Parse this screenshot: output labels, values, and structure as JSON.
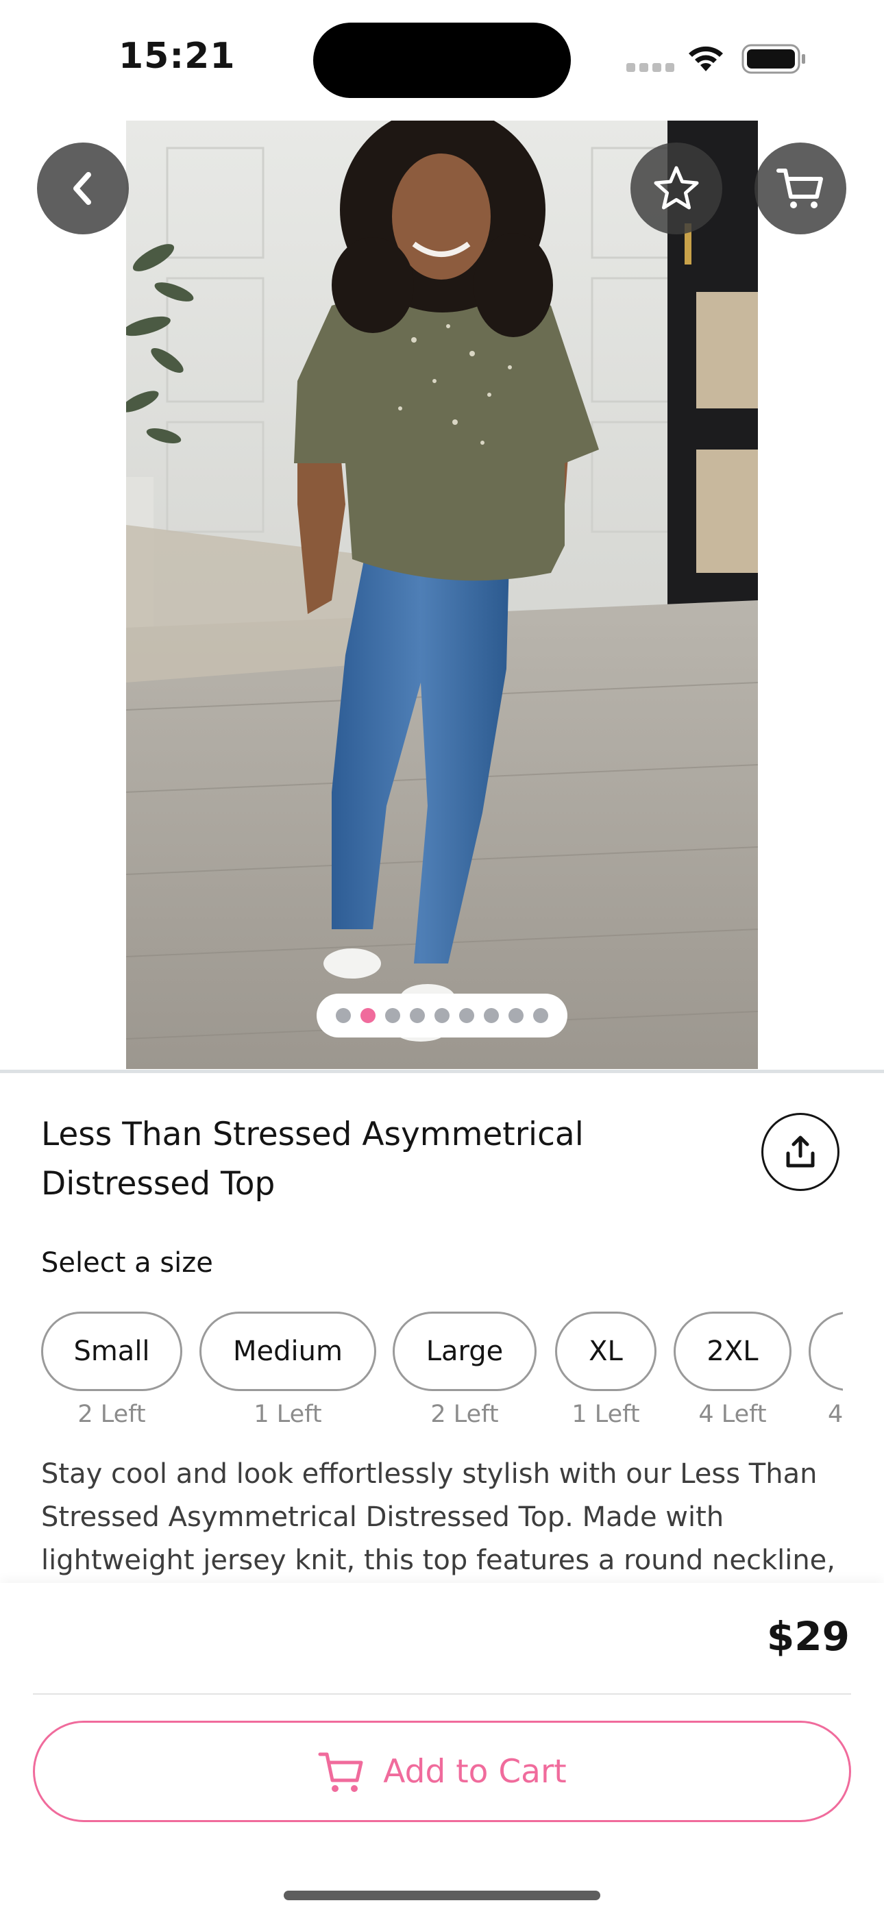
{
  "status_bar": {
    "time": "15:21"
  },
  "colors": {
    "accent": "#f06b9c",
    "pager_inactive": "#a8abb1",
    "muted_text": "#8c8c8c"
  },
  "icons": {
    "back": "chevron-left-icon",
    "favorite": "star-icon",
    "cart": "shopping-cart-icon",
    "share": "share-icon"
  },
  "gallery": {
    "image_count": 9,
    "active_index": 1
  },
  "product": {
    "title": "Less Than Stressed Asymmetrical Distressed Top",
    "size_label": "Select a size",
    "sizes": [
      {
        "label": "Small",
        "stock": "2 Left"
      },
      {
        "label": "Medium",
        "stock": "1 Left"
      },
      {
        "label": "Large",
        "stock": "2 Left"
      },
      {
        "label": "XL",
        "stock": "1 Left"
      },
      {
        "label": "2XL",
        "stock": "4 Left"
      },
      {
        "label": "",
        "stock": "4"
      }
    ],
    "description": "Stay cool and look effortlessly stylish with our Less Than Stressed Asymmetrical Distressed Top. Made with lightweight jersey knit, this top features a round neckline,",
    "price": "$29"
  },
  "actions": {
    "add_to_cart_label": "Add to Cart"
  }
}
